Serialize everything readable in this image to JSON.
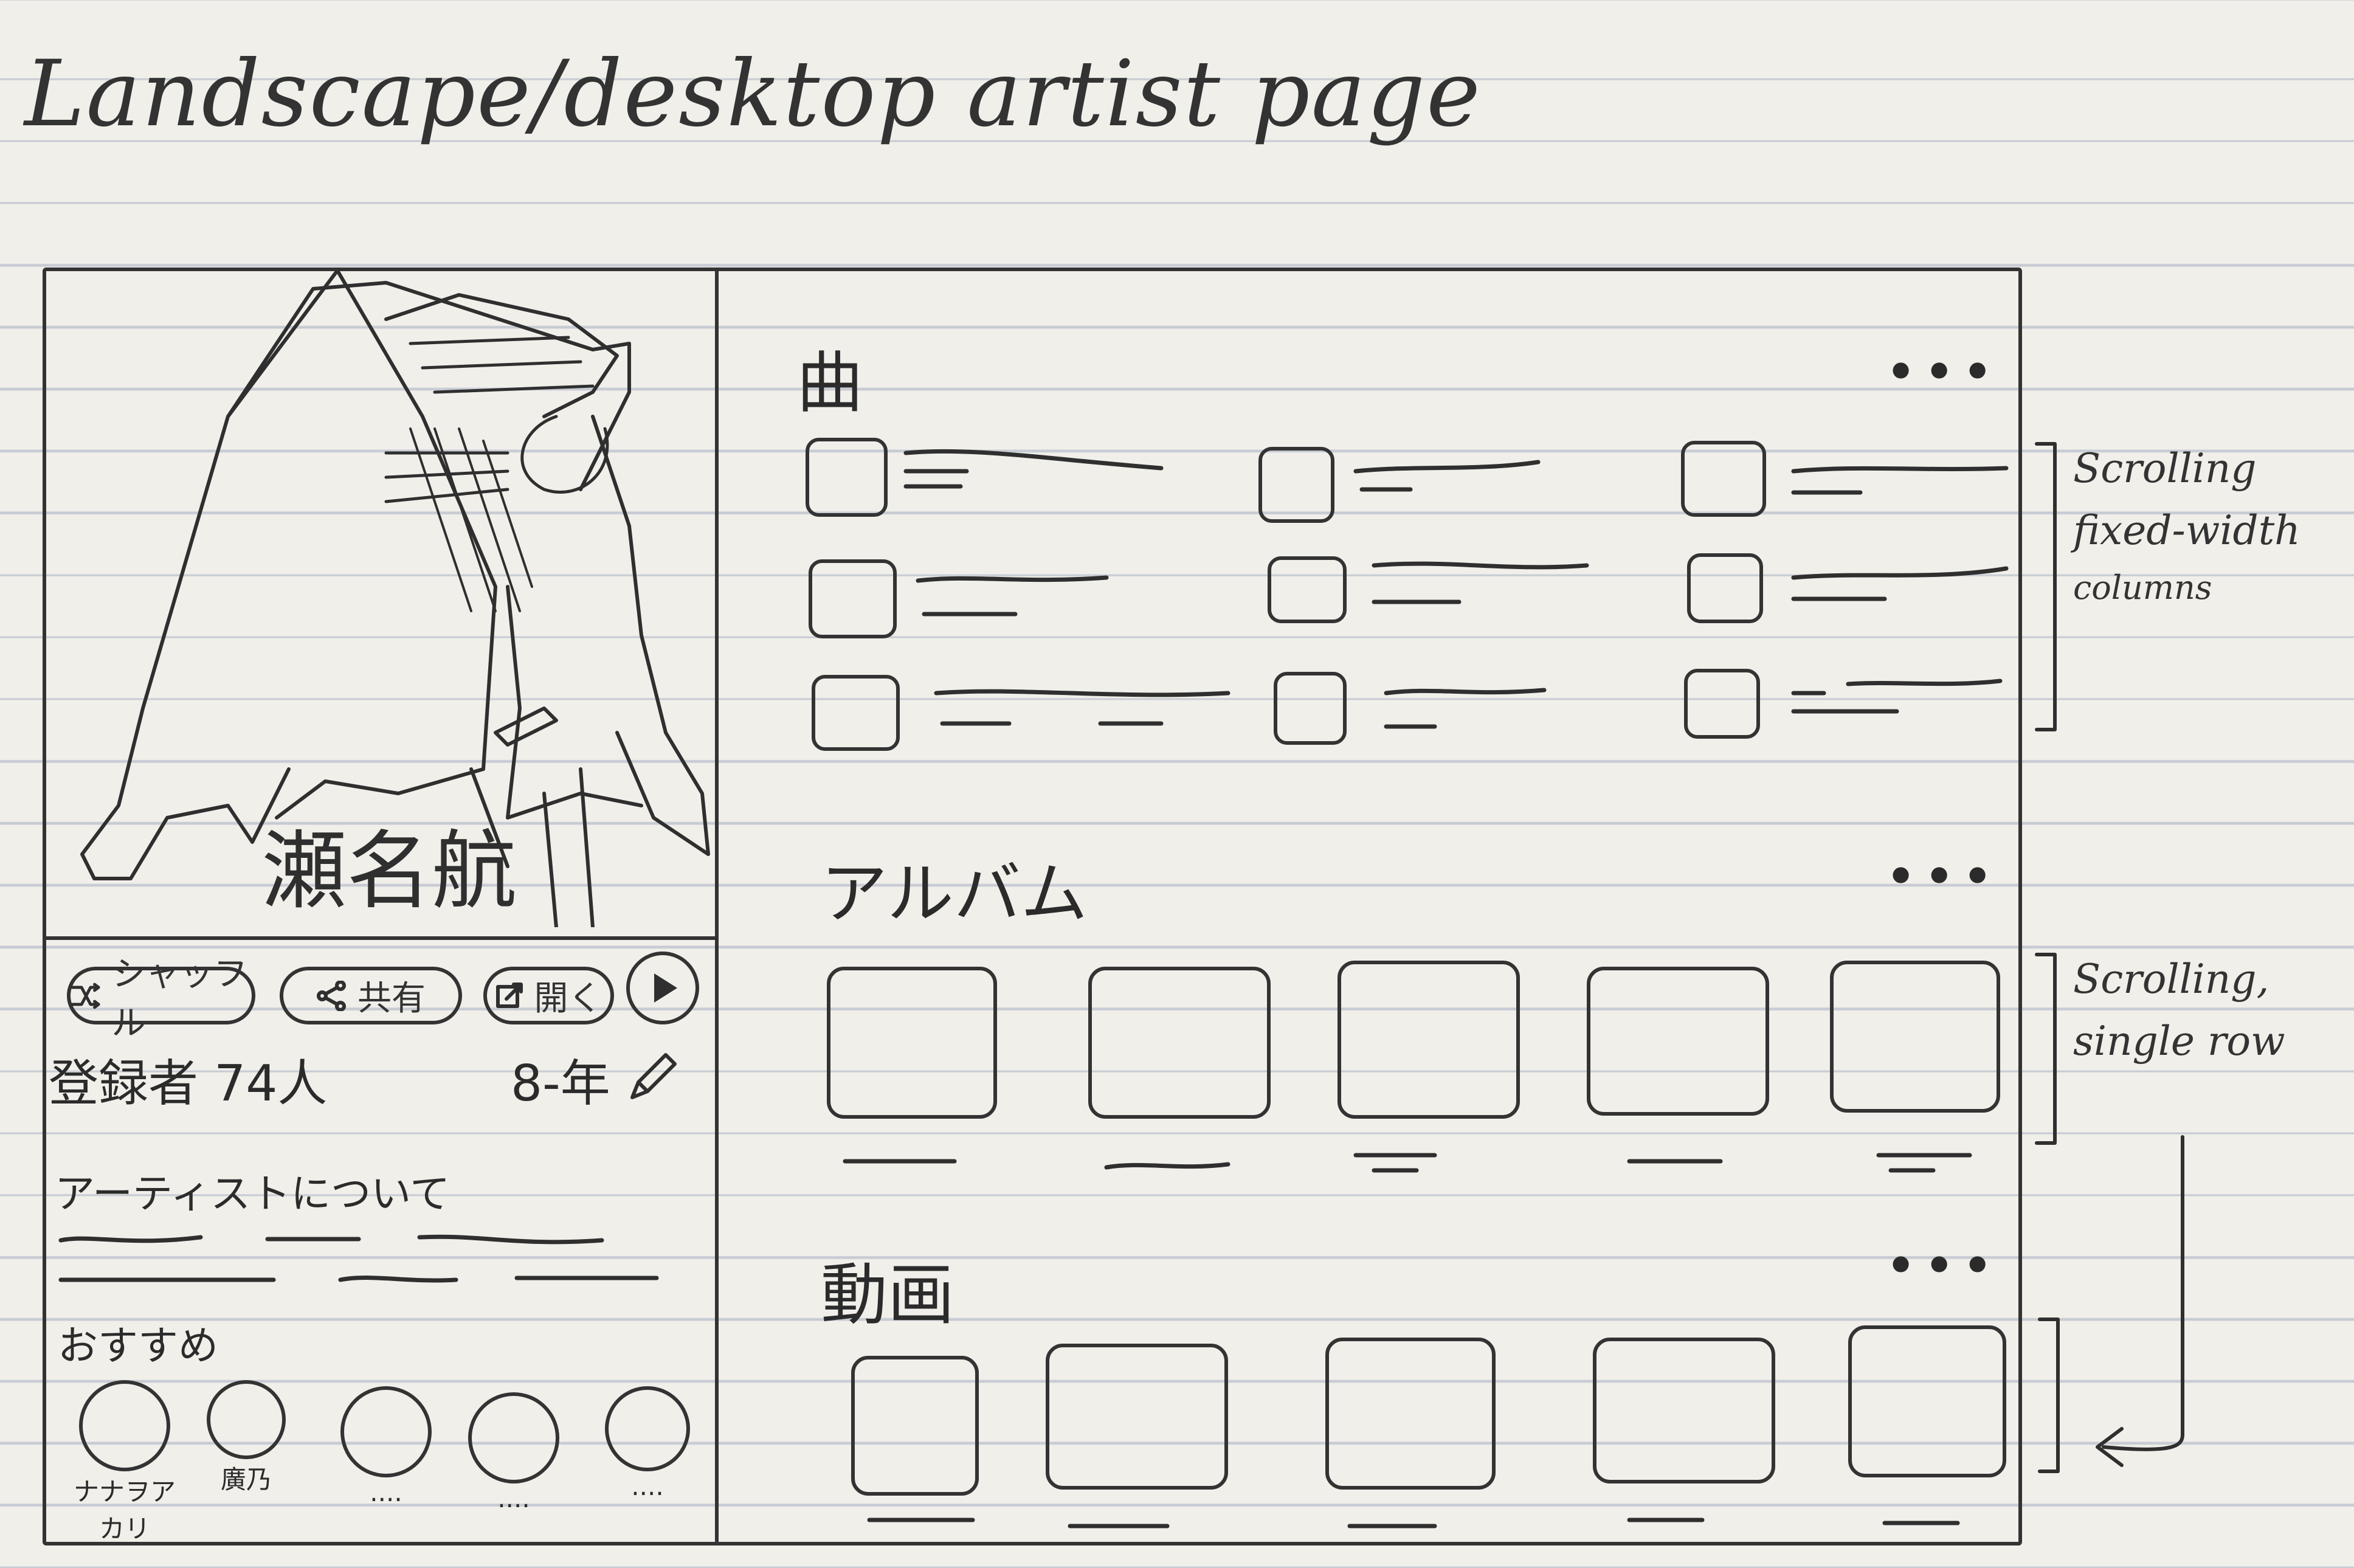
{
  "page_title": "Landscape/desktop artist page",
  "artist": {
    "name": "瀬名航",
    "subscribers": "登録者 74人",
    "years": "8-年"
  },
  "actions": {
    "shuffle": "シャッフル",
    "share": "共有",
    "open": "開く"
  },
  "about_heading": "アーティストについて",
  "recommended": {
    "heading": "おすすめ",
    "items": [
      "ナナヲアカリ",
      "廣乃",
      "....",
      "....",
      "...."
    ]
  },
  "sections": {
    "songs": {
      "heading": "曲",
      "more": "•••"
    },
    "albums": {
      "heading": "アルバム",
      "more": "•••"
    },
    "videos": {
      "heading": "動画",
      "more": "•••"
    }
  },
  "annotations": {
    "songs": [
      "Scrolling",
      "fixed-width",
      "columns"
    ],
    "albums": [
      "Scrolling,",
      "single row"
    ]
  },
  "icons": {
    "shuffle": "shuffle-icon",
    "share": "share-icon",
    "open": "open-icon",
    "play": "play-icon",
    "edit": "pencil-icon"
  }
}
